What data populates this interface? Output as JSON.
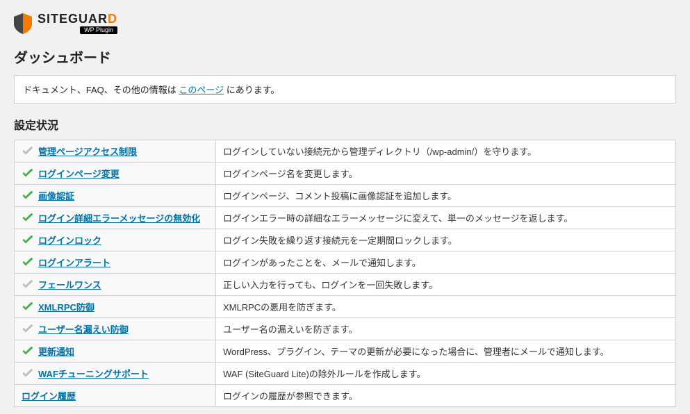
{
  "logo": {
    "name_left": "SITEGUAR",
    "name_accent": "D",
    "subtitle": "WP Plugin"
  },
  "page_title": "ダッシュボード",
  "notice": {
    "prefix": "ドキュメント、FAQ、その他の情報は ",
    "link": "このページ",
    "suffix": " にあります。"
  },
  "section_title": "設定状況",
  "settings": [
    {
      "enabled": false,
      "name": "管理ページアクセス制限",
      "desc": "ログインしていない接続元から管理ディレクトリ（/wp-admin/）を守ります。"
    },
    {
      "enabled": true,
      "name": "ログインページ変更",
      "desc": "ログインページ名を変更します。"
    },
    {
      "enabled": true,
      "name": "画像認証",
      "desc": "ログインページ、コメント投稿に画像認証を追加します。"
    },
    {
      "enabled": true,
      "name": "ログイン詳細エラーメッセージの無効化",
      "desc": "ログインエラー時の詳細なエラーメッセージに変えて、単一のメッセージを返します。"
    },
    {
      "enabled": true,
      "name": "ログインロック",
      "desc": "ログイン失敗を繰り返す接続元を一定期間ロックします。"
    },
    {
      "enabled": true,
      "name": "ログインアラート",
      "desc": "ログインがあったことを、メールで通知します。"
    },
    {
      "enabled": false,
      "name": "フェールワンス",
      "desc": "正しい入力を行っても、ログインを一回失敗します。"
    },
    {
      "enabled": true,
      "name": "XMLRPC防御",
      "desc": "XMLRPCの悪用を防ぎます。"
    },
    {
      "enabled": false,
      "name": "ユーザー名漏えい防御",
      "desc": "ユーザー名の漏えいを防ぎます。"
    },
    {
      "enabled": true,
      "name": "更新通知",
      "desc": "WordPress、プラグイン、テーマの更新が必要になった場合に、管理者にメールで通知します。"
    },
    {
      "enabled": false,
      "name": "WAFチューニングサポート",
      "desc": "WAF (SiteGuard Lite)の除外ルールを作成します。"
    },
    {
      "enabled": null,
      "name": "ログイン履歴",
      "desc": "ログインの履歴が参照できます。"
    }
  ]
}
